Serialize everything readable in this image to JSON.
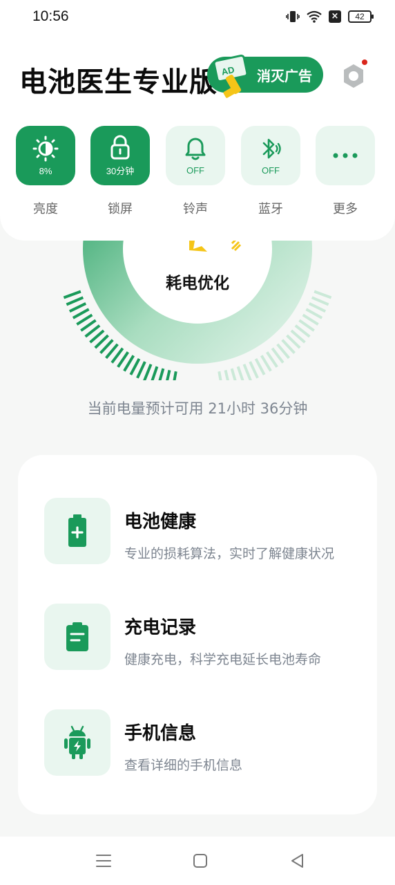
{
  "status_bar": {
    "time": "10:56",
    "battery_level": "42",
    "icons": [
      "vibrate-icon",
      "wifi-icon",
      "x-icon",
      "battery-icon"
    ]
  },
  "header": {
    "title": "电池医生专业版",
    "ad_button_label": "消灭广告",
    "settings_icon": "gear-icon"
  },
  "quick_settings": [
    {
      "label": "亮度",
      "value": "8%",
      "icon": "brightness-icon",
      "state": "on"
    },
    {
      "label": "锁屏",
      "value": "30分钟",
      "icon": "lock-icon",
      "state": "on"
    },
    {
      "label": "铃声",
      "value": "OFF",
      "icon": "bell-icon",
      "state": "off"
    },
    {
      "label": "蓝牙",
      "value": "OFF",
      "icon": "bluetooth-icon",
      "state": "off"
    },
    {
      "label": "更多",
      "value": "",
      "icon": "more-icon",
      "state": "off"
    }
  ],
  "gauge": {
    "label": "耗电优化"
  },
  "estimate_text": "当前电量预计可用 21小时 36分钟",
  "features": [
    {
      "title": "电池健康",
      "desc": "专业的损耗算法，实时了解健康状况",
      "icon": "battery-plus-icon"
    },
    {
      "title": "充电记录",
      "desc": "健康充电，科学充电延长电池寿命",
      "icon": "clipboard-icon"
    },
    {
      "title": "手机信息",
      "desc": "查看详细的手机信息",
      "icon": "android-icon"
    }
  ],
  "nav_bar": {
    "icons": [
      "menu-icon",
      "home-icon",
      "back-icon"
    ]
  },
  "colors": {
    "accent": "#1a9a5a",
    "accent_light": "#e9f6ef",
    "muted_text": "#7d8590"
  }
}
